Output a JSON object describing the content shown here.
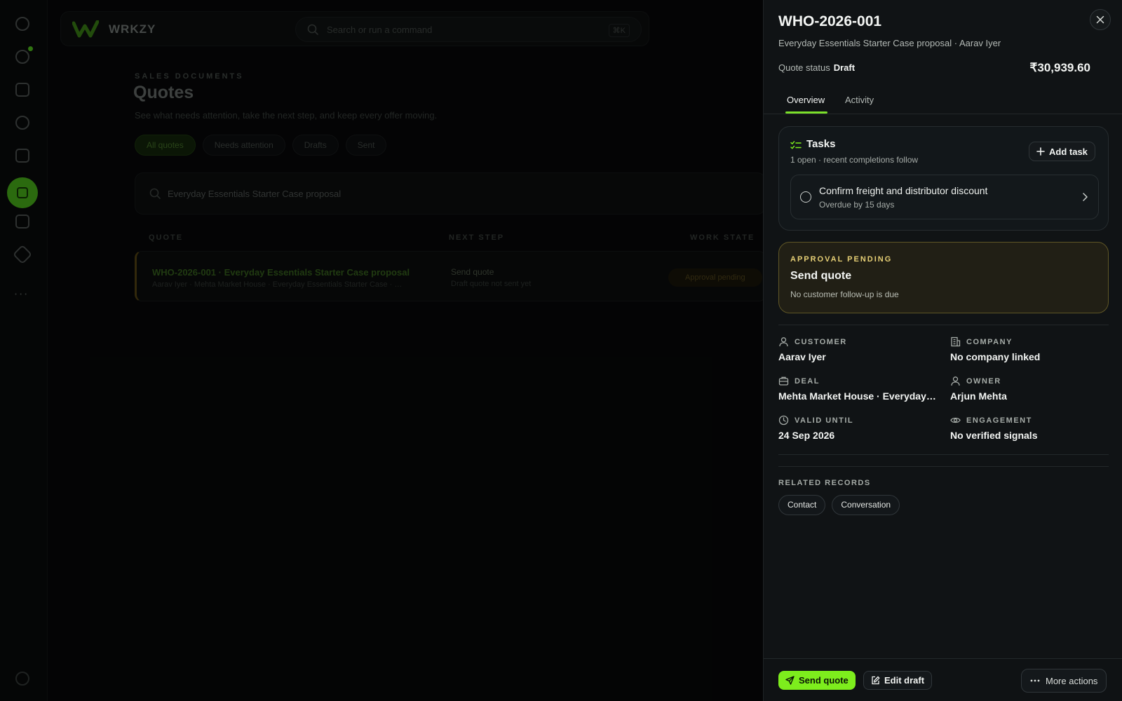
{
  "app": {
    "brand": "WRKZY",
    "search_placeholder": "Search or run a command",
    "search_shortcut": "⌘K",
    "eyebrow": "SALES DOCUMENTS",
    "page_title": "Quotes",
    "page_subtitle": "See what needs attention, take the next step, and keep every offer moving.",
    "filters": [
      "All quotes",
      "Needs attention",
      "Drafts",
      "Sent"
    ],
    "list_search_value": "Everyday Essentials Starter Case proposal",
    "table_headers": [
      "QUOTE",
      "NEXT STEP",
      "WORK STATE"
    ],
    "row": {
      "title": "WHO-2026-001 · Everyday Essentials Starter Case proposal",
      "meta": "Aarav Iyer · Mehta Market House · Everyday Essentials Starter Case · …",
      "next_step": "Send quote",
      "next_step_detail": "Draft quote not sent yet",
      "badge": "Approval pending"
    }
  },
  "drawer": {
    "title": "WHO-2026-001",
    "subtitle": "Everyday Essentials Starter Case proposal · Aarav Iyer",
    "status_label": "Quote status",
    "status_value": "Draft",
    "amount": "₹30,939.60",
    "tabs": [
      "Overview",
      "Activity"
    ],
    "tasks": {
      "title": "Tasks",
      "summary": "1 open · recent completions follow",
      "add_label": "Add task",
      "item_title": "Confirm freight and distributor discount",
      "item_due": "Overdue by 15 days"
    },
    "approval": {
      "eyebrow": "APPROVAL PENDING",
      "title": "Send quote",
      "detail": "No customer follow-up is due"
    },
    "fields": {
      "customer_label": "CUSTOMER",
      "customer_value": "Aarav Iyer",
      "company_label": "COMPANY",
      "company_value": "No company linked",
      "deal_label": "DEAL",
      "deal_value": "Mehta Market House · Everyday Essentials Starter Case",
      "owner_label": "OWNER",
      "owner_value": "Arjun Mehta",
      "valid_label": "VALID UNTIL",
      "valid_value": "24 Sep 2026",
      "engagement_label": "ENGAGEMENT",
      "engagement_value": "No verified signals"
    },
    "related_label": "RELATED RECORDS",
    "related": [
      "Contact",
      "Conversation"
    ],
    "footer": {
      "send_label": "Send quote",
      "edit_label": "Edit draft",
      "more_label": "More actions"
    }
  },
  "colors": {
    "accent": "#7ded1d",
    "approval_border": "#5f5626",
    "approval_eyebrow": "#e6cf75"
  }
}
